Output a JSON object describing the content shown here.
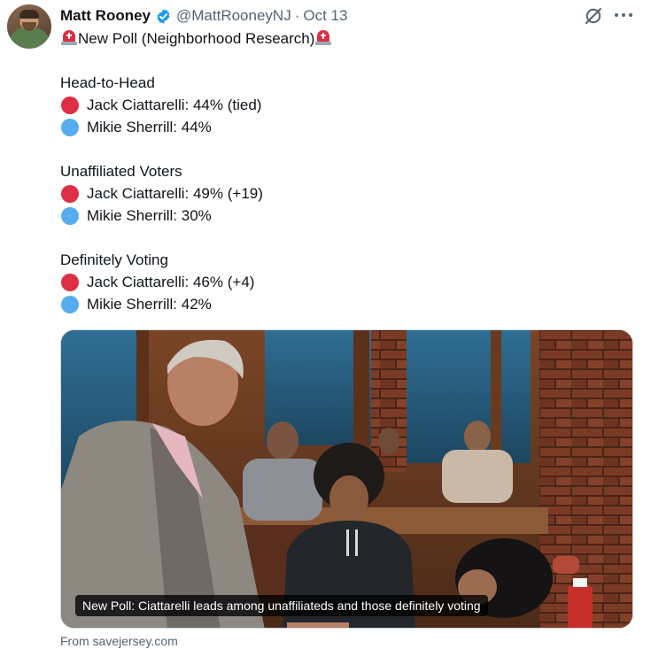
{
  "author": {
    "name": "Matt Rooney",
    "handle": "@MattRooneyNJ",
    "separator": "·",
    "date": "Oct 13",
    "verified": true,
    "avatar_icon": "profile-photo"
  },
  "icons": {
    "grok": "grok-icon",
    "more": "more-icon",
    "siren": "police-car-light-emoji",
    "red_circle": "red-circle-emoji",
    "blue_circle": "blue-circle-emoji"
  },
  "colors": {
    "verified_badge": "#1d9bf0",
    "red": "#dd2e44",
    "blue": "#55acee",
    "secondary_text": "#536471"
  },
  "post": {
    "intro": "New Poll (Neighborhood Research)",
    "sections": [
      {
        "heading": "Head-to-Head",
        "lines": [
          {
            "color": "red",
            "text": "Jack Ciattarelli: 44% (tied)"
          },
          {
            "color": "blue",
            "text": "Mikie Sherrill: 44%"
          }
        ]
      },
      {
        "heading": "Unaffiliated Voters",
        "lines": [
          {
            "color": "red",
            "text": "Jack Ciattarelli: 49% (+19)"
          },
          {
            "color": "blue",
            "text": "Mikie Sherrill: 30%"
          }
        ]
      },
      {
        "heading": "Definitely Voting",
        "lines": [
          {
            "color": "red",
            "text": "Jack Ciattarelli: 46% (+4)"
          },
          {
            "color": "blue",
            "text": "Mikie Sherrill: 42%"
          }
        ]
      }
    ]
  },
  "card": {
    "caption": "New Poll: Ciattarelli leads among unaffiliateds and those definitely voting",
    "source": "From savejersey.com"
  }
}
